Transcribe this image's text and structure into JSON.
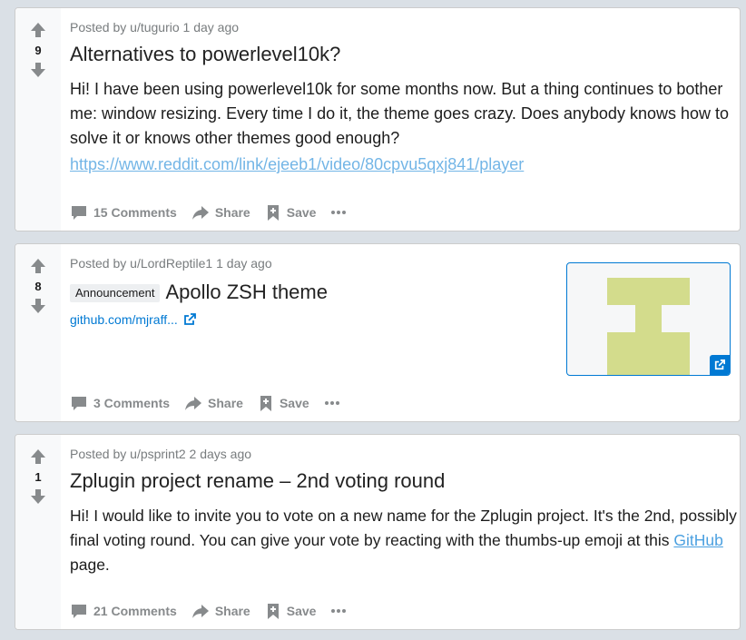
{
  "posts": [
    {
      "score": "9",
      "meta": "Posted by u/tugurio 1 day ago",
      "title": "Alternatives to powerlevel10k?",
      "body": "Hi! I have been using powerlevel10k for some months now. But a thing continues to bother me: window resizing. Every time I do it, the theme goes crazy. Does anybody knows how to solve it or knows other themes good enough?",
      "link": "https://www.reddit.com/link/ejeeb1/video/80cpvu5qxj841/player",
      "comments": "15 Comments",
      "share": "Share",
      "save": "Save"
    },
    {
      "score": "8",
      "meta": "Posted by u/LordReptile1 1 day ago",
      "flair": "Announcement",
      "title": "Apollo ZSH theme",
      "domain": "github.com/mjraff...",
      "comments": "3 Comments",
      "share": "Share",
      "save": "Save"
    },
    {
      "score": "1",
      "meta": "Posted by u/psprint2 2 days ago",
      "title": "Zplugin project rename – 2nd voting round",
      "body_before": "Hi! I would like to invite you to vote on a new name for the Zplugin project. It's the 2nd, possibly final voting round. You can give your vote by reacting with the thumbs-up emoji at this ",
      "body_link": "GitHub",
      "body_after": " page.",
      "comments": "21 Comments",
      "share": "Share",
      "save": "Save"
    }
  ],
  "icons": {
    "upvote": "arrow-up-icon",
    "downvote": "arrow-down-icon",
    "comments": "comment-icon",
    "share": "share-icon",
    "save": "bookmark-plus-icon",
    "more": "more-icon",
    "external": "external-link-icon"
  },
  "colors": {
    "link": "#0079d3",
    "thumbnail_art": "#d3dc8c"
  }
}
